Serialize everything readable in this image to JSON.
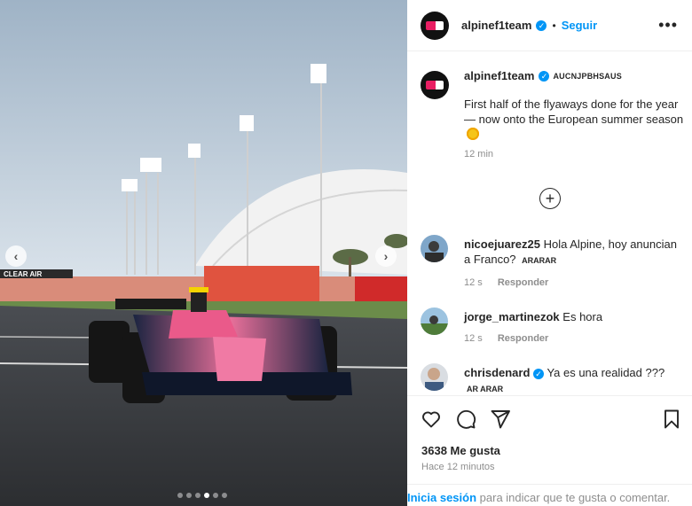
{
  "post": {
    "username": "alpinef1team",
    "follow_label": "Seguir",
    "separator": "•",
    "more_label": "•••",
    "caption_tag": "AUCNJPBHSAUS",
    "caption_text": "First half of the flyaways done for the year — now onto the European summer season",
    "caption_time": "12 min",
    "likes": "3638 Me gusta",
    "posted_ago": "Hace 12 minutos"
  },
  "media": {
    "nav_prev_label": "‹",
    "nav_next_label": "›",
    "slides_total": 6,
    "active_slide": 4,
    "sign_text": "CLEAR AIR"
  },
  "comments": [
    {
      "user": "nicoejuarez25",
      "verified": false,
      "text": "Hola Alpine, hoy anuncian a Franco?",
      "tag": "ARARAR",
      "time": "12 s",
      "reply": "Responder"
    },
    {
      "user": "jorge_martinezok",
      "verified": false,
      "text": "Es hora",
      "tag": "",
      "time": "12 s",
      "reply": "Responder"
    },
    {
      "user": "chrisdenard",
      "verified": true,
      "text": "Ya es una realidad ???",
      "tag": "AR ARAR",
      "time": "",
      "reply": ""
    }
  ],
  "footer": {
    "login_label": "Inicia sesión",
    "login_suffix": " para indicar que te gusta o comentar."
  },
  "icons": {
    "like": "heart-icon",
    "comment": "comment-icon",
    "share": "share-icon",
    "save": "bookmark-icon",
    "load_more": "plus-circle-icon",
    "verified": "verified-badge-icon"
  },
  "colors": {
    "link_blue": "#0095f6",
    "secondary_text": "#8e8e8e",
    "alpine_pink": "#e91e63",
    "alpine_blue": "#1e3a8a"
  }
}
